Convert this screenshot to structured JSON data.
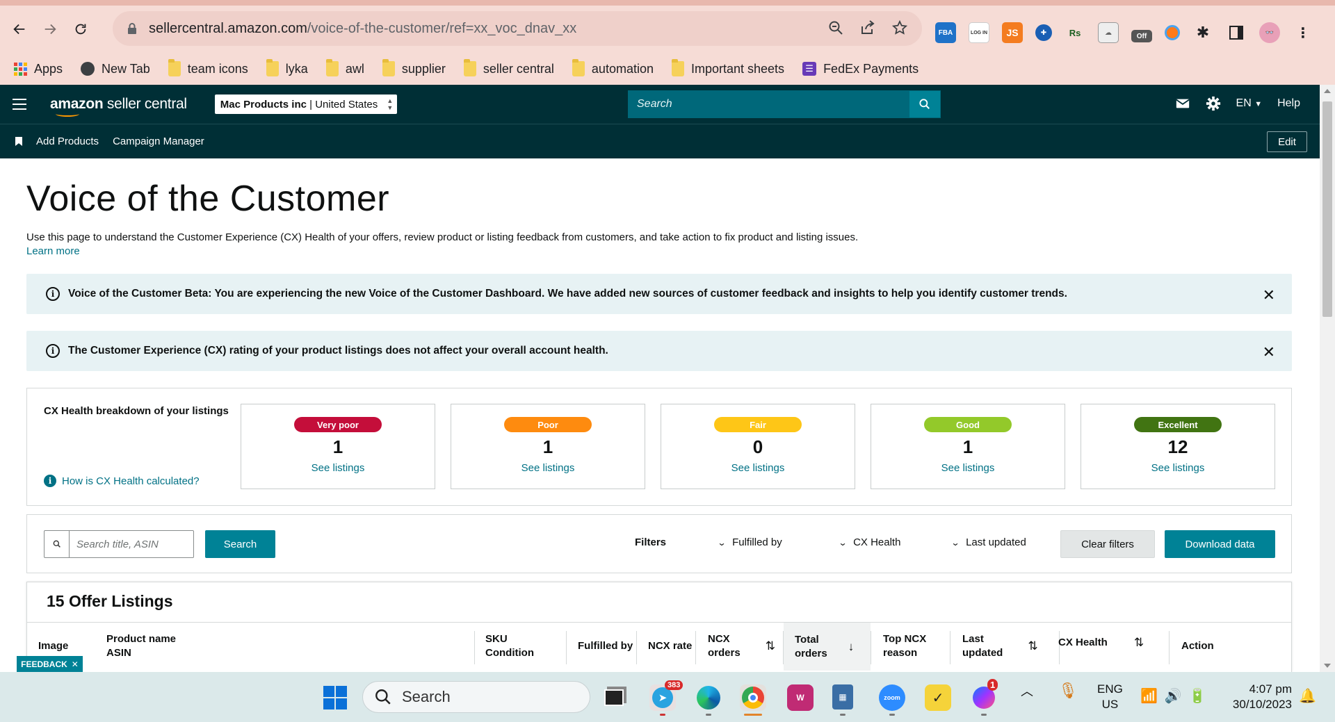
{
  "browser": {
    "url_host": "sellercentral.amazon.com",
    "url_path": "/voice-of-the-customer/ref=xx_voc_dnav_xx",
    "extensions": [
      "FBA",
      "LOG IN",
      "JS",
      "Off"
    ],
    "bookmarks": [
      {
        "label": "Apps",
        "icon": "apps-grid-icon"
      },
      {
        "label": "New Tab",
        "icon": "globe-icon"
      },
      {
        "label": "team icons",
        "icon": "folder-icon"
      },
      {
        "label": "lyka",
        "icon": "folder-icon"
      },
      {
        "label": "awl",
        "icon": "folder-icon"
      },
      {
        "label": "supplier",
        "icon": "folder-icon"
      },
      {
        "label": "seller central",
        "icon": "folder-icon"
      },
      {
        "label": "automation",
        "icon": "folder-icon"
      },
      {
        "label": "Important sheets",
        "icon": "folder-icon"
      },
      {
        "label": "FedEx Payments",
        "icon": "sheets-icon"
      }
    ]
  },
  "header": {
    "logo_bold": "amazon",
    "logo_rest": " seller central",
    "store_name": "Mac Products inc",
    "store_country": "United States",
    "search_placeholder": "Search",
    "lang": "EN",
    "help": "Help"
  },
  "subnav": {
    "links": [
      "Add Products",
      "Campaign Manager"
    ],
    "edit": "Edit"
  },
  "page": {
    "title": "Voice of the Customer",
    "description": "Use this page to understand the Customer Experience (CX) Health of your offers, review product or listing feedback from customers, and take action to fix product and listing issues.",
    "learn_more": "Learn more"
  },
  "alerts": [
    "Voice of the Customer Beta: You are experiencing the new Voice of the Customer Dashboard. We have added new sources of customer feedback and insights to help you identify customer trends.",
    "The Customer Experience (CX) rating of your product listings does not affect your overall account health."
  ],
  "health": {
    "label": "CX Health breakdown of your listings",
    "how_link": "How is CX Health calculated?",
    "cards": [
      {
        "rating": "Very poor",
        "count": "1",
        "link": "See listings",
        "color": "#c40e3a"
      },
      {
        "rating": "Poor",
        "count": "1",
        "link": "See listings",
        "color": "#fe8b0f"
      },
      {
        "rating": "Fair",
        "count": "0",
        "link": "See listings",
        "color": "#fec617"
      },
      {
        "rating": "Good",
        "count": "1",
        "link": "See listings",
        "color": "#93c92a"
      },
      {
        "rating": "Excellent",
        "count": "12",
        "link": "See listings",
        "color": "#417412"
      }
    ]
  },
  "filters": {
    "search_placeholder": "Search title, ASIN",
    "search_btn": "Search",
    "label": "Filters",
    "dropdowns": [
      "Fulfilled by",
      "CX Health",
      "Last updated"
    ],
    "clear": "Clear filters",
    "download": "Download data"
  },
  "table": {
    "title": "15 Offer Listings",
    "columns": {
      "image": "Image",
      "product_1": "Product name",
      "product_2": "ASIN",
      "sku_1": "SKU",
      "sku_2": "Condition",
      "fulfilled": "Fulfilled by",
      "ncx_rate": "NCX rate",
      "ncx_orders_1": "NCX",
      "ncx_orders_2": "orders",
      "total_1": "Total",
      "total_2": "orders",
      "top_1": "Top NCX",
      "top_2": "reason",
      "last_1": "Last",
      "last_2": "updated",
      "cx": "CX Health",
      "action": "Action"
    }
  },
  "feedback": "FEEDBACK",
  "taskbar": {
    "search": "Search",
    "telegram_badge": "383",
    "messenger_badge": "1",
    "lang_1": "ENG",
    "lang_2": "US",
    "time": "4:07 pm",
    "date": "30/10/2023"
  }
}
